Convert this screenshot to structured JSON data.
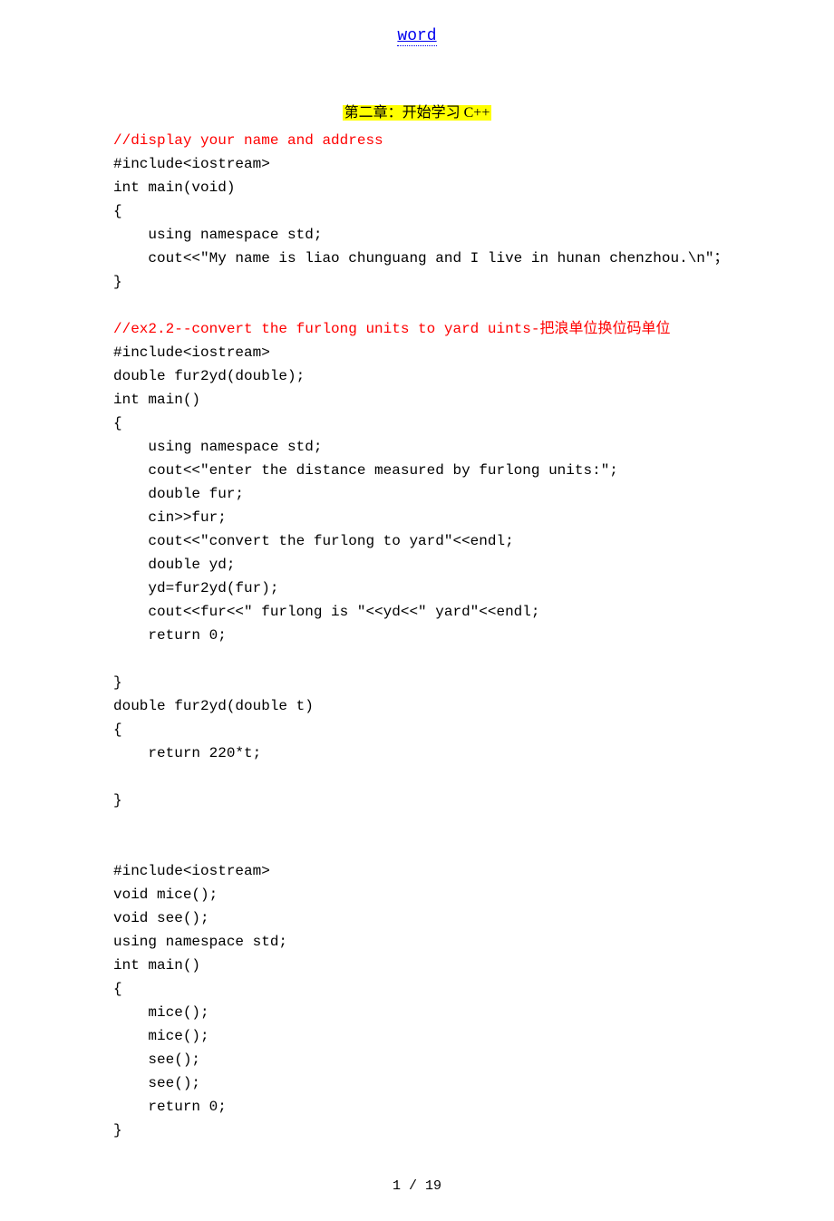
{
  "header": {
    "link": "word"
  },
  "chapter": {
    "title": "第二章：开始学习 C++"
  },
  "code": {
    "block1": {
      "c1": "//display your name and address",
      "l1": "#include<iostream>",
      "l2": "int main(void)",
      "l3": "{",
      "l4": "    using namespace std;",
      "l5": "    cout<<\"My name is liao chunguang and I live in hunan chenzhou.\\n\"；",
      "l6": "}"
    },
    "block2": {
      "c1a": "//ex2.2--convert the furlong units to yard uints-",
      "c1b": "把浪单位换位码单位",
      "l1": "#include<iostream>",
      "l2": "double fur2yd(double);",
      "l3": "int main()",
      "l4": "{",
      "l5": "    using namespace std;",
      "l6": "    cout<<\"enter the distance measured by furlong units:\";",
      "l7": "    double fur;",
      "l8": "    cin>>fur;",
      "l9": "    cout<<\"convert the furlong to yard\"<<endl;",
      "l10": "    double yd;",
      "l11": "    yd=fur2yd(fur);",
      "l12": "    cout<<fur<<\" furlong is \"<<yd<<\" yard\"<<endl;",
      "l13": "    return 0;",
      "l14": "",
      "l15": "}",
      "l16": "double fur2yd(double t)",
      "l17": "{",
      "l18": "    return 220*t;",
      "l19": "",
      "l20": "}"
    },
    "block3": {
      "l0": "",
      "l1": "#include<iostream>",
      "l2": "void mice();",
      "l3": "void see();",
      "l4": "using namespace std;",
      "l5": "int main()",
      "l6": "{",
      "l7": "    mice();",
      "l8": "    mice();",
      "l9": "    see();",
      "l10": "    see();",
      "l11": "    return 0;",
      "l12": "}"
    }
  },
  "footer": {
    "pager": "1 / 19"
  }
}
